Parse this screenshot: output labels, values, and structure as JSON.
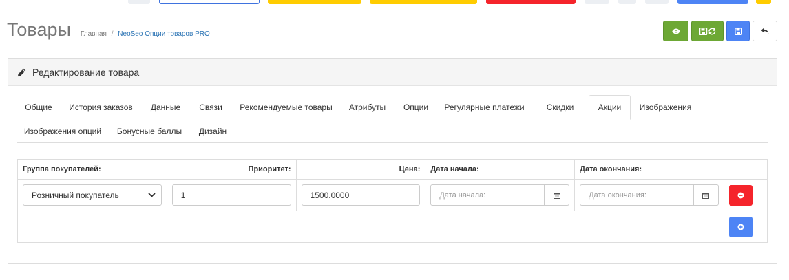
{
  "header": {
    "title": "Товары",
    "breadcrumb": {
      "home": "Главная",
      "separator": "/",
      "current": "NeoSeo Опции товаров PRO"
    }
  },
  "actions": {
    "preview_icon": "eye-icon",
    "save_stay_icon": "save-refresh-icon",
    "save_icon": "save-icon",
    "back_icon": "reply-icon"
  },
  "panel": {
    "title": "Редактирование товара",
    "title_icon": "pencil-icon"
  },
  "tabs": [
    {
      "label": "Общие"
    },
    {
      "label": "История заказов"
    },
    {
      "label": "Данные"
    },
    {
      "label": "Связи"
    },
    {
      "label": "Рекомендуемые товары"
    },
    {
      "label": "Атрибуты"
    },
    {
      "label": "Опции"
    },
    {
      "label": "Регулярные платежи"
    },
    {
      "label": "Скидки"
    },
    {
      "label": "Акции",
      "active": true
    },
    {
      "label": "Изображения"
    },
    {
      "label": "Изображения опций"
    },
    {
      "label": "Бонусные баллы"
    },
    {
      "label": "Дизайн"
    }
  ],
  "table": {
    "headers": {
      "group": "Группа покупателей:",
      "priority": "Приоритет:",
      "price": "Цена:",
      "date_start": "Дата начала:",
      "date_end": "Дата окончания:"
    },
    "row": {
      "group_value": "Розничный покупатель",
      "priority_value": "1",
      "price_value": "1500.0000",
      "date_start_placeholder": "Дата начала:",
      "date_end_placeholder": "Дата окончания:"
    }
  },
  "colors": {
    "green": "#6da835",
    "blue": "#4d84f5",
    "red": "#f5242b"
  }
}
